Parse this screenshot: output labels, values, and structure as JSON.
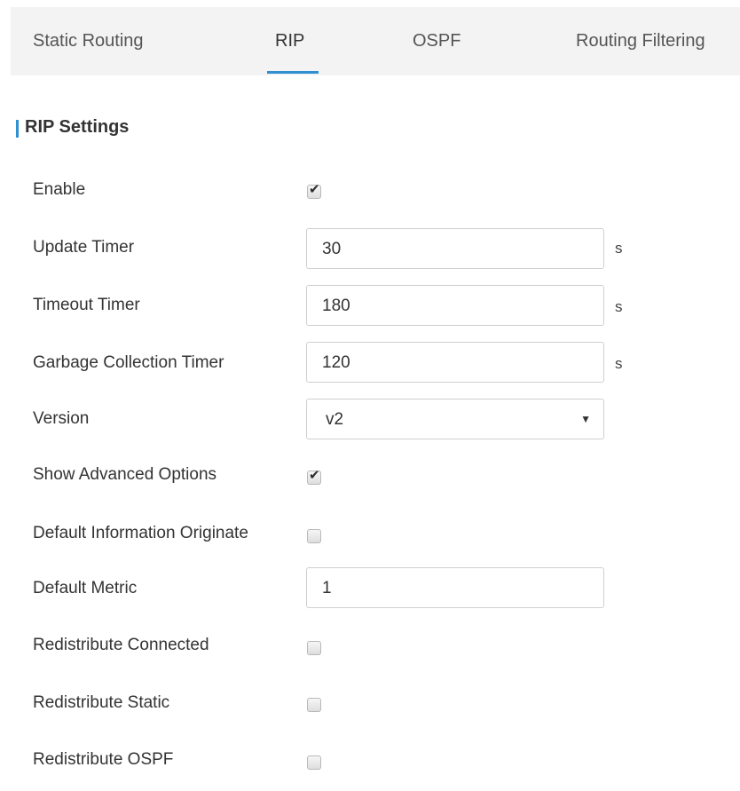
{
  "tabs": {
    "static_routing": "Static Routing",
    "rip": "RIP",
    "ospf": "OSPF",
    "routing_filtering": "Routing Filtering",
    "active": "RIP"
  },
  "section": {
    "title": "RIP Settings"
  },
  "fields": {
    "enable": {
      "label": "Enable",
      "checked": true
    },
    "update_timer": {
      "label": "Update Timer",
      "value": "30",
      "unit": "s"
    },
    "timeout_timer": {
      "label": "Timeout Timer",
      "value": "180",
      "unit": "s"
    },
    "garbage_collection_timer": {
      "label": "Garbage Collection Timer",
      "value": "120",
      "unit": "s"
    },
    "version": {
      "label": "Version",
      "value": "v2",
      "caret": "▼"
    },
    "show_advanced_options": {
      "label": "Show Advanced Options",
      "checked": true
    },
    "default_information_originate": {
      "label": "Default Information Originate",
      "checked": false
    },
    "default_metric": {
      "label": "Default Metric",
      "value": "1"
    },
    "redistribute_connected": {
      "label": "Redistribute Connected",
      "checked": false
    },
    "redistribute_static": {
      "label": "Redistribute Static",
      "checked": false
    },
    "redistribute_ospf": {
      "label": "Redistribute OSPF",
      "checked": false
    }
  },
  "icons": {
    "checkmark": "✔"
  },
  "colors": {
    "accent": "#2f8fd1",
    "tabbar_bg": "#f3f3f3"
  }
}
